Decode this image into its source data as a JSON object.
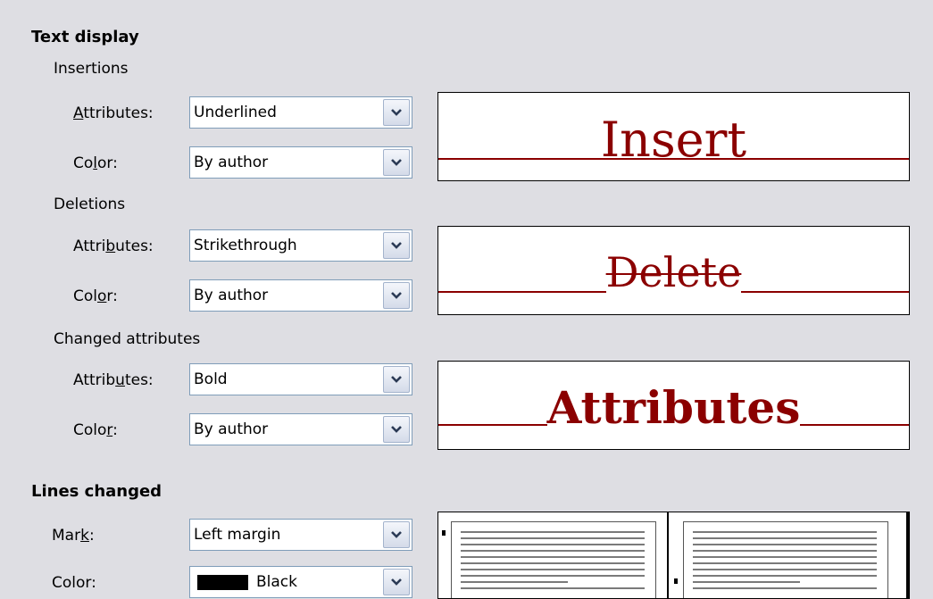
{
  "text_display": {
    "title": "Text display",
    "insertions": {
      "title": "Insertions",
      "attributes_label": "Attributes:",
      "attributes_value": "Underlined",
      "color_label": "Color:",
      "color_value": "By author",
      "preview_text": "Insert"
    },
    "deletions": {
      "title": "Deletions",
      "attributes_label": "Attributes:",
      "attributes_value": "Strikethrough",
      "color_label": "Color:",
      "color_value": "By author",
      "preview_text": "Delete"
    },
    "changed_attributes": {
      "title": "Changed attributes",
      "attributes_label": "Attributes:",
      "attributes_value": "Bold",
      "color_label": "Color:",
      "color_value": "By author",
      "preview_text": "Attributes"
    }
  },
  "lines_changed": {
    "title": "Lines changed",
    "mark_label": "Mark:",
    "mark_value": "Left margin",
    "color_label": "Color:",
    "color_value": "Black",
    "color_swatch": "#000000"
  },
  "colors": {
    "change_color": "#8b0000",
    "dialog_background": "#dedee3",
    "dropdown_border": "#7f9db9"
  },
  "icons": {
    "dropdown": "chevron-down-icon"
  }
}
